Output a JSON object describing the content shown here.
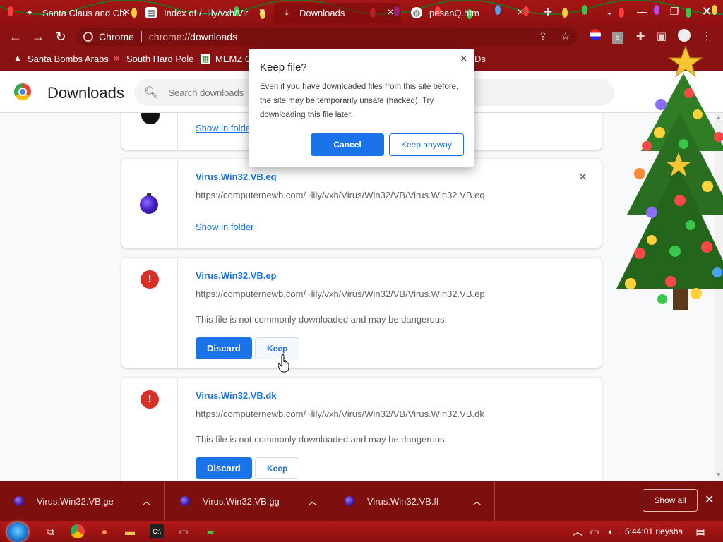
{
  "tabs": [
    {
      "label": "Santa Claus and Christ",
      "favicon": "santa-icon",
      "active": false
    },
    {
      "label": "Index of /~lily/vxh/Vir",
      "favicon": "folder-icon",
      "active": false
    },
    {
      "label": "Downloads",
      "favicon": "download-icon",
      "active": true
    },
    {
      "label": "pesanQ.htm",
      "favicon": "globe-icon",
      "active": false
    }
  ],
  "address_bar": {
    "site_label": "Chrome",
    "scheme": "chrome://",
    "path": "downloads"
  },
  "bookmarks": [
    {
      "label": "Santa Bombs Arabs",
      "icon": "santa-icon"
    },
    {
      "label": "South Hard Pole",
      "icon": "snowflake-icon"
    },
    {
      "label": "MEMZ C",
      "icon": "memz-icon"
    },
    {
      "label": "Ds",
      "icon": ""
    }
  ],
  "downloads_page": {
    "title": "Downloads",
    "search_placeholder": "Search downloads"
  },
  "download_items": [
    {
      "show_in_folder": "Show in folder"
    },
    {
      "filename": "Virus.Win32.VB.eq",
      "url": "https://computernewb.com/~lily/vxh/Virus/Win32/VB/Virus.Win32.VB.eq",
      "show_in_folder": "Show in folder"
    },
    {
      "filename": "Virus.Win32.VB.ep",
      "url": "https://computernewb.com/~lily/vxh/Virus/Win32/VB/Virus.Win32.VB.ep",
      "warning": "This file is not commonly downloaded and may be dangerous.",
      "discard_label": "Discard",
      "keep_label": "Keep"
    },
    {
      "filename": "Virus.Win32.VB.dk",
      "url": "https://computernewb.com/~lily/vxh/Virus/Win32/VB/Virus.Win32.VB.dk",
      "warning": "This file is not commonly downloaded and may be dangerous.",
      "discard_label": "Discard",
      "keep_label": "Keep"
    }
  ],
  "dialog": {
    "title": "Keep file?",
    "body": "Even if you have downloaded files from this site before, the site may be temporarily unsafe (hacked). Try downloading this file later.",
    "cancel_label": "Cancel",
    "keep_anyway_label": "Keep anyway"
  },
  "shelf": {
    "items": [
      {
        "label": "Virus.Win32.VB.ge"
      },
      {
        "label": "Virus.Win32.VB.gg"
      },
      {
        "label": "Virus.Win32.VB.ff"
      }
    ],
    "show_all_label": "Show all"
  },
  "taskbar": {
    "clock": "5:44:01 rieysha"
  },
  "colors": {
    "chrome_frame": "#8b1212",
    "accent_blue": "#1a73e8",
    "danger_red": "#d93025"
  }
}
